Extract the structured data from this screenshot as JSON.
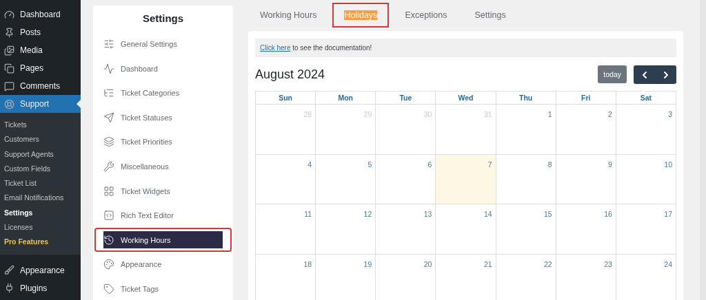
{
  "admin_menu": {
    "top": [
      {
        "label": "Dashboard",
        "selected": false
      },
      {
        "label": "Posts",
        "selected": false
      },
      {
        "label": "Media",
        "selected": false
      },
      {
        "label": "Pages",
        "selected": false
      },
      {
        "label": "Comments",
        "selected": false
      },
      {
        "label": "Support",
        "selected": true
      }
    ],
    "submenu": [
      {
        "label": "Tickets",
        "selected": false,
        "kind": "plain"
      },
      {
        "label": "Customers",
        "selected": false,
        "kind": "plain"
      },
      {
        "label": "Support Agents",
        "selected": false,
        "kind": "plain"
      },
      {
        "label": "Custom Fields",
        "selected": false,
        "kind": "plain"
      },
      {
        "label": "Ticket List",
        "selected": false,
        "kind": "plain"
      },
      {
        "label": "Email Notifications",
        "selected": false,
        "kind": "plain"
      },
      {
        "label": "Settings",
        "selected": true,
        "kind": "plain"
      },
      {
        "label": "Licenses",
        "selected": false,
        "kind": "plain"
      },
      {
        "label": "Pro Features",
        "selected": false,
        "kind": "pro"
      }
    ],
    "bottom": [
      {
        "label": "Appearance",
        "selected": false
      },
      {
        "label": "Plugins",
        "selected": false
      }
    ]
  },
  "settings_panel": {
    "title": "Settings",
    "items": [
      {
        "label": "General Settings",
        "selected": false,
        "highlighted": false
      },
      {
        "label": "Dashboard",
        "selected": false,
        "highlighted": false
      },
      {
        "label": "Ticket Categories",
        "selected": false,
        "highlighted": false
      },
      {
        "label": "Ticket Statuses",
        "selected": false,
        "highlighted": false
      },
      {
        "label": "Ticket Priorities",
        "selected": false,
        "highlighted": false
      },
      {
        "label": "Miscellaneous",
        "selected": false,
        "highlighted": false
      },
      {
        "label": "Ticket Widgets",
        "selected": false,
        "highlighted": false
      },
      {
        "label": "Rich Text Editor",
        "selected": false,
        "highlighted": false
      },
      {
        "label": "Working Hours",
        "selected": true,
        "highlighted": true
      },
      {
        "label": "Appearance",
        "selected": false,
        "highlighted": false
      },
      {
        "label": "Ticket Tags",
        "selected": false,
        "highlighted": false
      }
    ]
  },
  "tabs": [
    {
      "label": "Working Hours",
      "selected": false,
      "highlighted": false
    },
    {
      "label": "Holidays",
      "selected": true,
      "highlighted": true
    },
    {
      "label": "Exceptions",
      "selected": false,
      "highlighted": false
    },
    {
      "label": "Settings",
      "selected": false,
      "highlighted": false
    }
  ],
  "notice": {
    "link": "Click here",
    "text": " to see the documentation!"
  },
  "calendar": {
    "title": "August 2024",
    "today_button": "today",
    "weekdays": [
      "Sun",
      "Mon",
      "Tue",
      "Wed",
      "Thu",
      "Fri",
      "Sat"
    ],
    "weeks": [
      [
        {
          "day": "28",
          "other_month": true,
          "today": false
        },
        {
          "day": "29",
          "other_month": true,
          "today": false
        },
        {
          "day": "30",
          "other_month": true,
          "today": false
        },
        {
          "day": "31",
          "other_month": true,
          "today": false
        },
        {
          "day": "1",
          "other_month": false,
          "today": false
        },
        {
          "day": "2",
          "other_month": false,
          "today": false
        },
        {
          "day": "3",
          "other_month": false,
          "today": false
        }
      ],
      [
        {
          "day": "4",
          "other_month": false,
          "today": false
        },
        {
          "day": "5",
          "other_month": false,
          "today": false
        },
        {
          "day": "6",
          "other_month": false,
          "today": false
        },
        {
          "day": "7",
          "other_month": false,
          "today": true
        },
        {
          "day": "8",
          "other_month": false,
          "today": false
        },
        {
          "day": "9",
          "other_month": false,
          "today": false
        },
        {
          "day": "10",
          "other_month": false,
          "today": false
        }
      ],
      [
        {
          "day": "11",
          "other_month": false,
          "today": false
        },
        {
          "day": "12",
          "other_month": false,
          "today": false
        },
        {
          "day": "13",
          "other_month": false,
          "today": false
        },
        {
          "day": "14",
          "other_month": false,
          "today": false
        },
        {
          "day": "15",
          "other_month": false,
          "today": false
        },
        {
          "day": "16",
          "other_month": false,
          "today": false
        },
        {
          "day": "17",
          "other_month": false,
          "today": false
        }
      ],
      [
        {
          "day": "18",
          "other_month": false,
          "today": false
        },
        {
          "day": "19",
          "other_month": false,
          "today": false
        },
        {
          "day": "20",
          "other_month": false,
          "today": false
        },
        {
          "day": "21",
          "other_month": false,
          "today": false
        },
        {
          "day": "22",
          "other_month": false,
          "today": false
        },
        {
          "day": "23",
          "other_month": false,
          "today": false
        },
        {
          "day": "24",
          "other_month": false,
          "today": false
        }
      ]
    ]
  }
}
